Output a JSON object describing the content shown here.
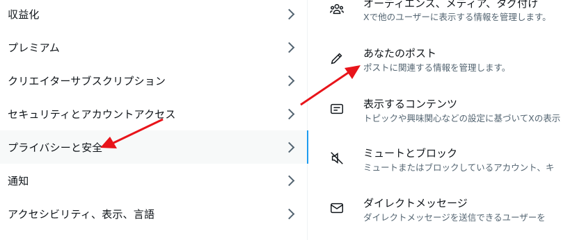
{
  "left_menu": {
    "items": [
      {
        "label": "収益化"
      },
      {
        "label": "プレミアム"
      },
      {
        "label": "クリエイターサブスクリプション"
      },
      {
        "label": "セキュリティとアカウントアクセス"
      },
      {
        "label": "プライバシーと安全"
      },
      {
        "label": "通知"
      },
      {
        "label": "アクセシビリティ、表示、言語"
      }
    ]
  },
  "right_menu": {
    "items": [
      {
        "title": "オーディエンス、メディア、タグ付け",
        "desc": "Xで他のユーザーに表示する情報を管理します。",
        "icon": "people-icon"
      },
      {
        "title": "あなたのポスト",
        "desc": "ポストに関連する情報を管理します。",
        "icon": "pencil-icon"
      },
      {
        "title": "表示するコンテンツ",
        "desc": "トピックや興味関心などの設定に基づいてXの表示",
        "icon": "content-icon"
      },
      {
        "title": "ミュートとブロック",
        "desc": "ミュートまたはブロックしているアカウント、キ",
        "icon": "mute-icon"
      },
      {
        "title": "ダイレクトメッセージ",
        "desc": "ダイレクトメッセージを送信できるユーザーを",
        "icon": "envelope-icon"
      }
    ]
  },
  "colors": {
    "accent": "#1d9bf0",
    "arrow": "#e8141a",
    "secondary_text": "#536471"
  }
}
